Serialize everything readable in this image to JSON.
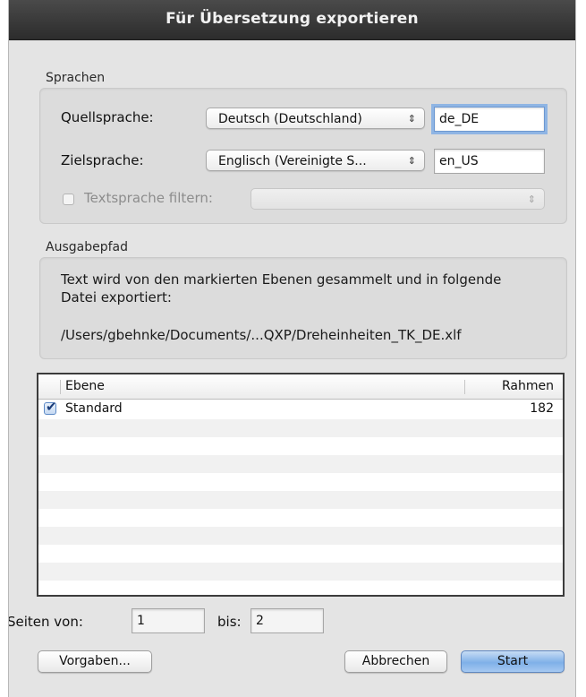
{
  "window": {
    "title": "Für Übersetzung exportieren"
  },
  "languages": {
    "section_label": "Sprachen",
    "source_label": "Quellsprache:",
    "source_value": "Deutsch (Deutschland)",
    "source_code": "de_DE",
    "target_label": "Zielsprache:",
    "target_value": "Englisch (Vereinigte S...",
    "target_code": "en_US",
    "filter_label": "Textsprache filtern:",
    "filter_checked": false
  },
  "output": {
    "section_label": "Ausgabepfad",
    "description": "Text wird von den markierten Ebenen gesammelt und in folgende Datei exportiert:",
    "path": "/Users/gbehnke/Documents/...QXP/Dreheinheiten_TK_DE.xlf"
  },
  "table": {
    "columns": [
      "Ebene",
      "Rahmen"
    ],
    "rows": [
      {
        "checked": true,
        "name": "Standard",
        "count": "182"
      }
    ]
  },
  "pages": {
    "from_label": "Seiten von:",
    "from_value": "1",
    "to_label": "bis:",
    "to_value": "2"
  },
  "buttons": {
    "defaults": "Vorgaben...",
    "cancel": "Abbrechen",
    "start": "Start"
  },
  "icons": {
    "popup_arrows": "⇕",
    "check": "✔"
  }
}
